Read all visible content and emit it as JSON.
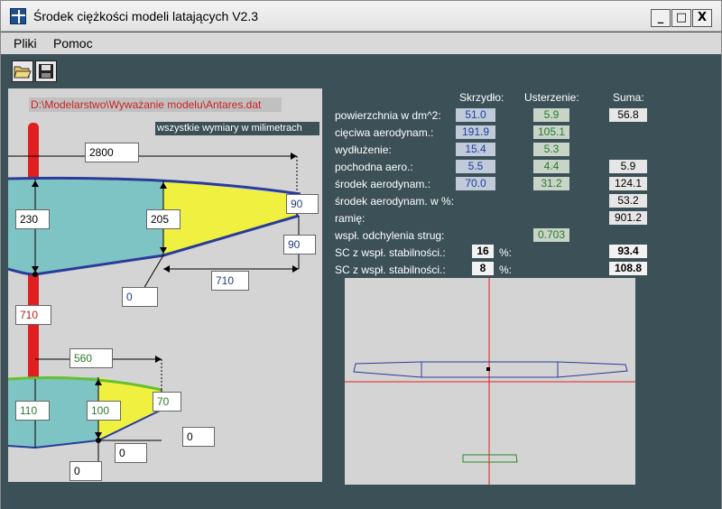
{
  "window": {
    "title": "Środek ciężkości modeli latających V2.3",
    "min_label": "_",
    "max_label": "□",
    "close_label": "X"
  },
  "menu": {
    "items": [
      "Pliki",
      "Pomoc"
    ]
  },
  "toolbar": {
    "open_icon": "open-folder-icon",
    "save_icon": "save-disk-icon"
  },
  "left": {
    "file_path": "D:\\Modelarstwo\\Wyważanie modelu\\Antares.dat",
    "units_note": "wszystkie wymiary w milimetrach",
    "wing": {
      "span": "2800",
      "root_chord": "230",
      "mid_chord": "205",
      "tip_chord": "90",
      "tip_sweep": "90",
      "break_offset": "0",
      "outer_span": "710"
    },
    "fuselage_distance": "710",
    "stabilizer": {
      "span": "560",
      "root_chord": "110",
      "mid_chord": "100",
      "tip_chord": "70",
      "tip_offset": "0",
      "mid_offset": "0",
      "root_offset": "0"
    }
  },
  "results": {
    "columns": {
      "wing": "Skrzydło:",
      "stab": "Usterzenie:",
      "sum": "Suma:"
    },
    "rows": [
      {
        "label": "powierzchnia w dm^2:",
        "wing": "51.0",
        "stab": "5.9",
        "sum": "56.8"
      },
      {
        "label": "cięciwa aerodynam.:",
        "wing": "191.9",
        "stab": "105.1",
        "sum": ""
      },
      {
        "label": "wydłużenie:",
        "wing": "15.4",
        "stab": "5.3",
        "sum": ""
      },
      {
        "label": "pochodna aero.:",
        "wing": "5.5",
        "stab": "4.4",
        "sum": "5.9"
      },
      {
        "label": "środek aerodynam.:",
        "wing": "70.0",
        "stab": "31.2",
        "sum": "124.1"
      },
      {
        "label": "środek aerodynam. w %:",
        "wing": "",
        "stab": "",
        "sum": "53.2"
      },
      {
        "label": "ramię:",
        "wing": "",
        "stab": "",
        "sum": "901.2"
      },
      {
        "label": "wspł. odchylenia strug:",
        "wing": "",
        "stab": "0.703",
        "sum": ""
      }
    ],
    "sc1": {
      "label": "SC z wspł. stabilności.:",
      "value": "16",
      "unit": "%:",
      "result": "93.4"
    },
    "sc2": {
      "label": "SC z wspł. stabilności.:",
      "value": "8",
      "unit": "%:",
      "result": "108.8"
    }
  },
  "colors": {
    "background": "#3b5057",
    "wing_fill": "#7fc4c4",
    "wing_outline": "#2a3c9a",
    "flap_fill": "#f0f040",
    "fuselage": "#e02020",
    "stab_outline": "#66c030",
    "crosshair": "#e02020"
  }
}
